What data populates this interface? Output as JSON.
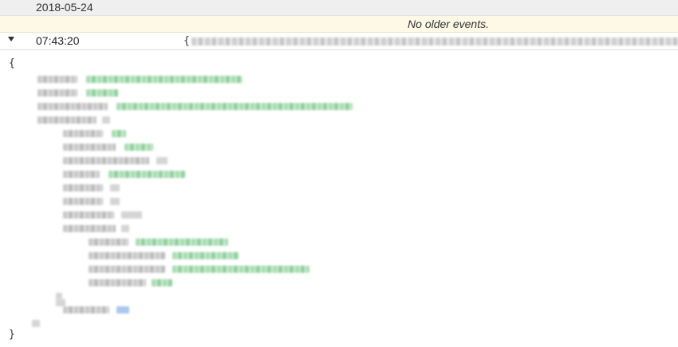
{
  "log": {
    "date_header": "2018-05-24",
    "notice": "No older events.",
    "event": {
      "time": "07:43:20",
      "preview_open": "{"
    }
  },
  "json_view": {
    "open_brace": "{",
    "close_brace": "}"
  },
  "icons": {
    "expand_toggle": "triangle-down-icon"
  },
  "colors": {
    "date_row_bg": "#efefef",
    "notice_row_bg": "#fdf9e6",
    "string_value": "#8fd09d",
    "boolean_value": "#a9c8ec"
  }
}
